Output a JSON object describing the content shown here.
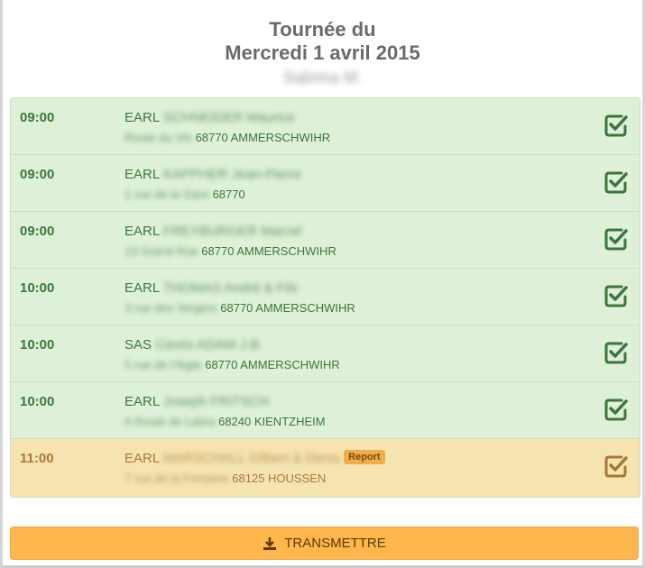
{
  "header": {
    "title_line1": "Tournée du",
    "title_line2": "Mercredi 1 avril 2015",
    "driver_name": "Sabrina M."
  },
  "stops": [
    {
      "time": "09:00",
      "company_type": "EARL",
      "company_name": "SCHNEIDER Maurice",
      "street": "Route du Vin",
      "postal_city": "68770 AMMERSCHWIHR",
      "tag": "",
      "status": "done"
    },
    {
      "time": "09:00",
      "company_type": "EARL",
      "company_name": "KAPPHER Jean-Pierre",
      "street": "1 rue de la Gare",
      "postal_city": "68770",
      "tag": "",
      "status": "done"
    },
    {
      "time": "09:00",
      "company_type": "EARL",
      "company_name": "FREYBURGER Marcel",
      "street": "13 Grand Rue",
      "postal_city": "68770 AMMERSCHWIHR",
      "tag": "",
      "status": "done"
    },
    {
      "time": "10:00",
      "company_type": "EARL",
      "company_name": "THOMAS André & Fils",
      "street": "3 rue des Vergers",
      "postal_city": "68770 AMMERSCHWIHR",
      "tag": "",
      "status": "done"
    },
    {
      "time": "10:00",
      "company_type": "SAS",
      "company_name": "Caves ADAM J.B.",
      "street": "5 rue de l'Aigle",
      "postal_city": "68770 AMMERSCHWIHR",
      "tag": "",
      "status": "done"
    },
    {
      "time": "10:00",
      "company_type": "EARL",
      "company_name": "Joseph FRITSCH",
      "street": "4 Route de Lebra",
      "postal_city": "68240 KIENTZHEIM",
      "tag": "",
      "status": "done"
    },
    {
      "time": "11:00",
      "company_type": "EARL",
      "company_name": "MARSCHALL Gilbert & Denis",
      "street": "7 rue de la Fontaine",
      "postal_city": "68125 HOUSSEN",
      "tag": "Report",
      "status": "postponed"
    }
  ],
  "colors": {
    "done_bg": "#dff0d8",
    "done_text": "#3c763d",
    "postponed_bg": "#f5e4b0",
    "postponed_text": "#a8783a",
    "button_bg": "#ffb64d"
  },
  "icons": {
    "status": "check-square-icon",
    "button": "download-icon"
  },
  "button": {
    "label": "TRANSMETTRE"
  }
}
